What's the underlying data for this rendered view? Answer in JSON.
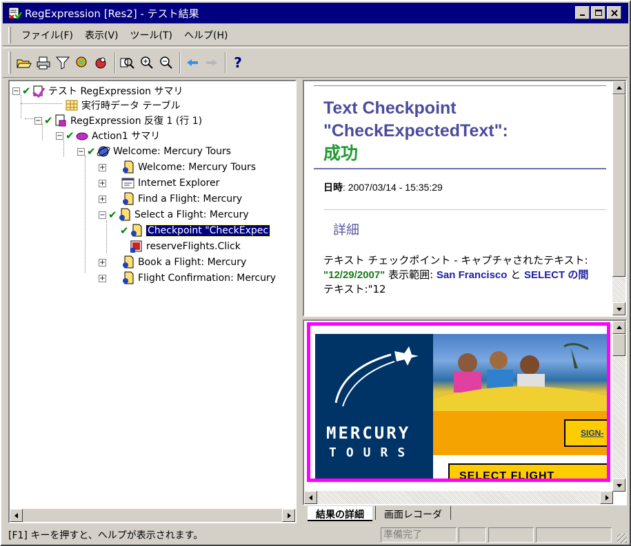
{
  "window": {
    "title": "RegExpression [Res2] - テスト結果",
    "min_label": "_",
    "max_label": "□",
    "close_label": "×"
  },
  "menu": {
    "items": [
      {
        "label": "ファイル(F)"
      },
      {
        "label": "表示(V)"
      },
      {
        "label": "ツール(T)"
      },
      {
        "label": "ヘルプ(H)"
      }
    ]
  },
  "toolbar": {
    "buttons": [
      {
        "icon": "open-folder-icon"
      },
      {
        "icon": "print-icon"
      },
      {
        "icon": "filter-icon"
      },
      {
        "icon": "find-icon"
      },
      {
        "icon": "bug-icon"
      },
      {
        "icon": "zoom-to-fit-icon"
      },
      {
        "icon": "zoom-in-icon"
      },
      {
        "icon": "zoom-out-icon"
      },
      {
        "icon": "back-arrow-icon"
      },
      {
        "icon": "forward-arrow-icon"
      },
      {
        "icon": "help-icon"
      }
    ],
    "help_glyph": "?"
  },
  "tree": {
    "items": [
      {
        "label": "テスト RegExpression サマリ",
        "checked": true
      },
      {
        "label": "実行時データ テーブル",
        "checked": false
      },
      {
        "label": "RegExpression 反復 1 (行 1)",
        "checked": true
      },
      {
        "label": "Action1 サマリ",
        "checked": true
      },
      {
        "label": "Welcome: Mercury Tours",
        "checked": true
      },
      {
        "label": "Welcome: Mercury Tours",
        "checked": false
      },
      {
        "label": "Internet Explorer",
        "checked": false
      },
      {
        "label": "Find a Flight: Mercury",
        "checked": false
      },
      {
        "label": "Select a Flight: Mercury",
        "checked": true
      },
      {
        "label": "Checkpoint \"CheckExpec",
        "checked": true,
        "selected": true
      },
      {
        "label": "reserveFlights.Click",
        "checked": false
      },
      {
        "label": "Book a Flight: Mercury",
        "checked": false
      },
      {
        "label": "Flight Confirmation: Mercury",
        "checked": false
      }
    ]
  },
  "details": {
    "title_line1": "Text Checkpoint",
    "title_line2": "\"CheckExpectedText\":",
    "status": "成功",
    "date_label": "日時",
    "date_value": ": 2007/03/14 - 15:35:29",
    "section": "詳細",
    "desc_prefix": "テキスト チェックポイント - キャプチャされたテキスト: ",
    "captured_text": "\"12/29/2007\"",
    "desc_range": " 表示範囲: ",
    "range_from": "San Francisco",
    "desc_and": " と ",
    "range_to": "SELECT の間",
    "desc_tail": "テキスト:\"12"
  },
  "screen_recorder": {
    "logo_main": "MERCURY",
    "logo_sub": "TOURS",
    "signon": "SIGN-",
    "select_flight": "SELECT FLIGHT"
  },
  "tabs": [
    {
      "label": "結果の詳細",
      "active": true
    },
    {
      "label": "画面レコーダ",
      "active": false
    }
  ],
  "status": {
    "help_text": "[F1] キーを押すと、ヘルプが表示されます。",
    "ready": "準備完了"
  }
}
